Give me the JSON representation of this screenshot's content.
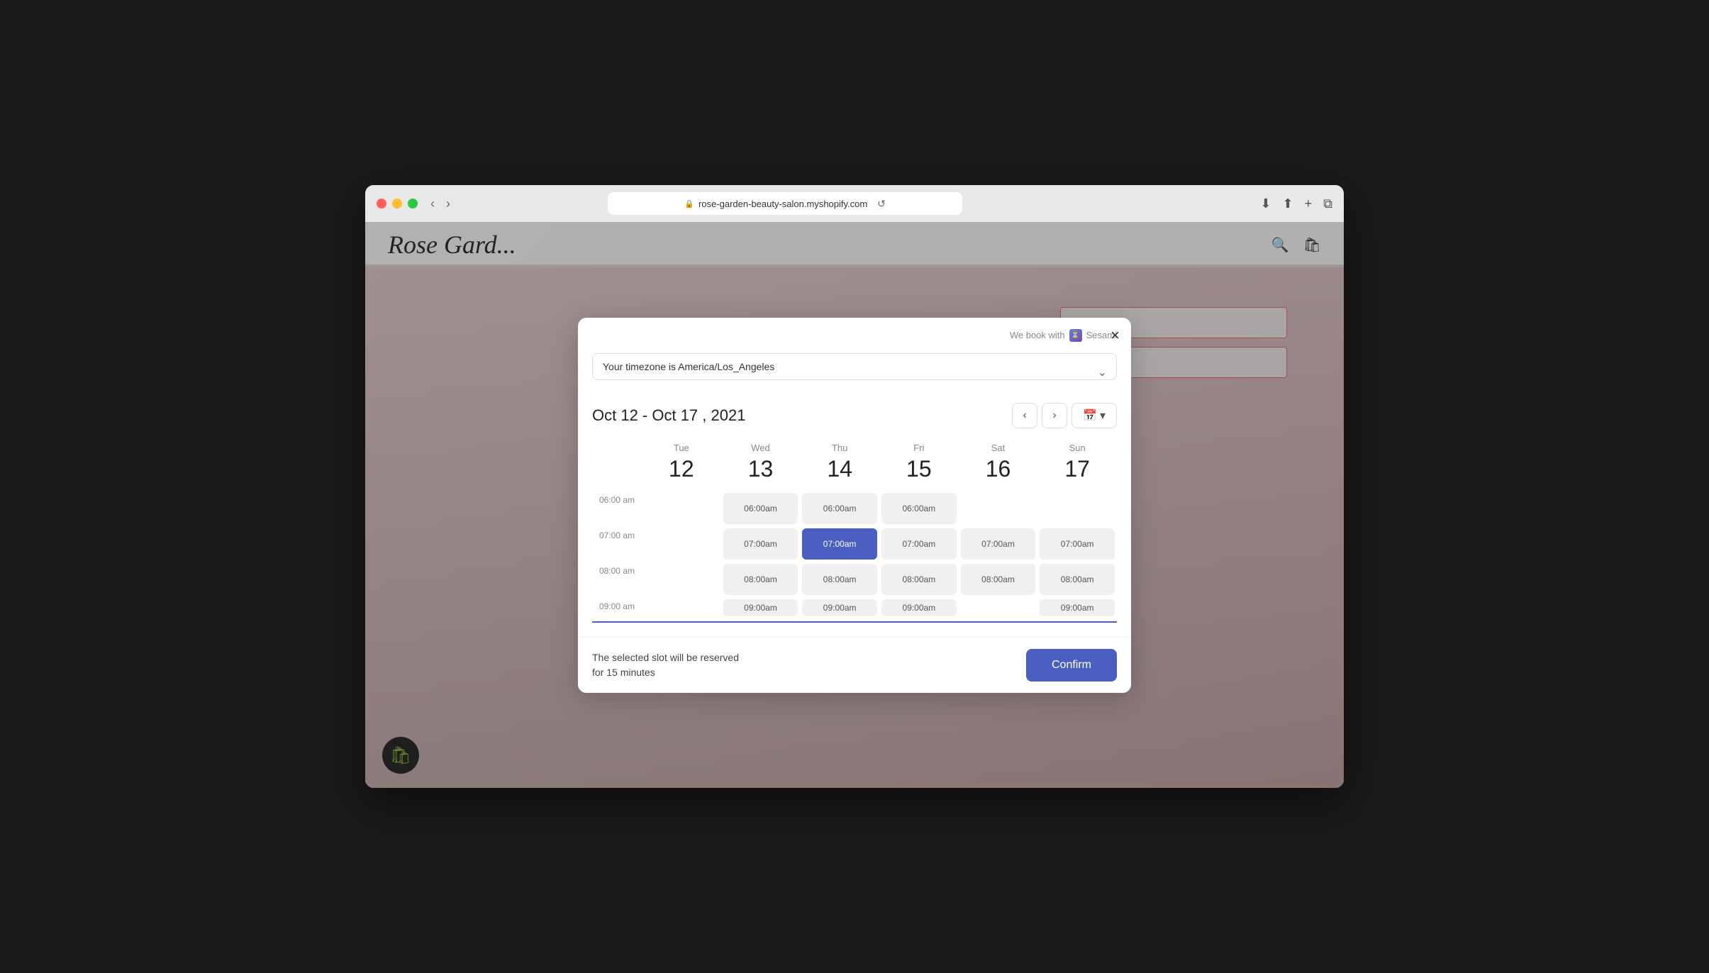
{
  "browser": {
    "url": "rose-garden-beauty-salon.myshopify.com",
    "back_label": "‹",
    "forward_label": "›",
    "reload_label": "↺"
  },
  "site": {
    "logo": "Rose Gard",
    "logo_full": "Rose Garden"
  },
  "modal": {
    "branding": "We book with",
    "branding_name": "Sesami",
    "close_label": "×",
    "timezone_label": "Your timezone is America/Los_Angeles",
    "timezone_value": "America/Los_Angeles",
    "week_range": "Oct  12  -  Oct  17 ,  2021",
    "prev_week_label": "‹",
    "next_week_label": "›",
    "reservation_notice_line1": "The selected slot will be reserved",
    "reservation_notice_line2": "for 15 minutes",
    "confirm_label": "Confirm"
  },
  "calendar": {
    "days": [
      {
        "name": "Tue",
        "number": "12"
      },
      {
        "name": "Wed",
        "number": "13"
      },
      {
        "name": "Thu",
        "number": "14"
      },
      {
        "name": "Fri",
        "number": "15"
      },
      {
        "name": "Sat",
        "number": "16"
      },
      {
        "name": "Sun",
        "number": "17"
      }
    ],
    "time_rows": [
      {
        "label": "06:00 am",
        "slots": [
          "",
          "06:00am",
          "06:00am",
          "06:00am",
          "",
          ""
        ]
      },
      {
        "label": "07:00 am",
        "slots": [
          "",
          "07:00am",
          "07:00am_selected",
          "07:00am",
          "07:00am",
          "07:00am"
        ]
      },
      {
        "label": "08:00 am",
        "slots": [
          "",
          "08:00am",
          "08:00am",
          "08:00am",
          "08:00am",
          "08:00am"
        ]
      },
      {
        "label": "09:00 am",
        "slots": [
          "",
          "09:00am",
          "09:00am",
          "09:00am",
          "",
          "09:00am"
        ]
      }
    ]
  }
}
